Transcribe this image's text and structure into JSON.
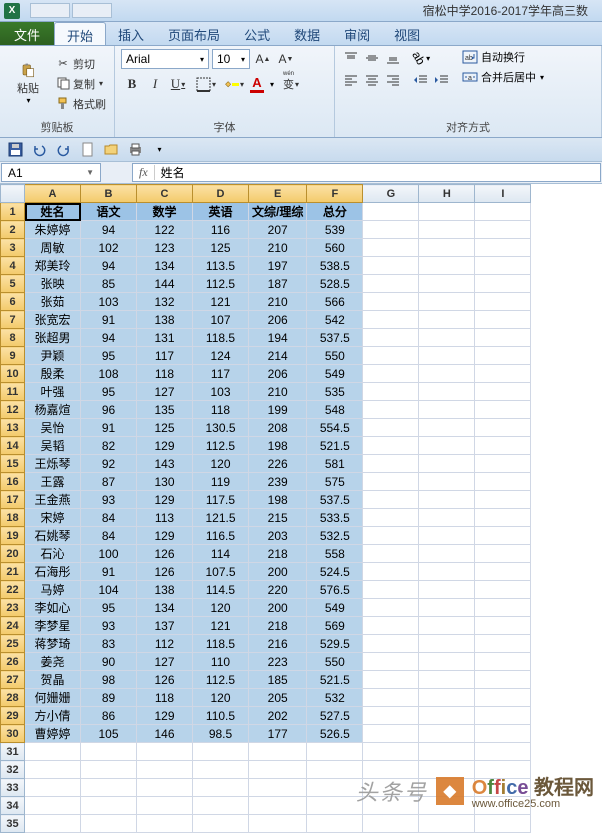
{
  "window": {
    "title": "宿松中学2016-2017学年高三数"
  },
  "ribbon": {
    "file": "文件",
    "tabs": [
      "开始",
      "插入",
      "页面布局",
      "公式",
      "数据",
      "审阅",
      "视图"
    ],
    "active": 0,
    "clipboard": {
      "paste": "粘贴",
      "cut": "剪切",
      "copy": "复制",
      "format_painter": "格式刷",
      "group_label": "剪贴板"
    },
    "font": {
      "name": "Arial",
      "size": "10",
      "group_label": "字体"
    },
    "alignment": {
      "wrap": "自动换行",
      "merge": "合并后居中",
      "group_label": "对齐方式"
    }
  },
  "fbar": {
    "name_box": "A1",
    "fx": "fx",
    "value": "姓名"
  },
  "columns": [
    "A",
    "B",
    "C",
    "D",
    "E",
    "F",
    "G",
    "H",
    "I"
  ],
  "selected_cols": [
    "A",
    "B",
    "C",
    "D",
    "E",
    "F"
  ],
  "row_count": 35,
  "selected_rows": 30,
  "chart_data": {
    "type": "table",
    "headers": [
      "姓名",
      "语文",
      "数学",
      "英语",
      "文综/理综",
      "总分"
    ],
    "rows": [
      [
        "朱婷婷",
        "94",
        "122",
        "116",
        "207",
        "539"
      ],
      [
        "周敏",
        "102",
        "123",
        "125",
        "210",
        "560"
      ],
      [
        "郑美玲",
        "94",
        "134",
        "113.5",
        "197",
        "538.5"
      ],
      [
        "张映",
        "85",
        "144",
        "112.5",
        "187",
        "528.5"
      ],
      [
        "张茹",
        "103",
        "132",
        "121",
        "210",
        "566"
      ],
      [
        "张宽宏",
        "91",
        "138",
        "107",
        "206",
        "542"
      ],
      [
        "张超男",
        "94",
        "131",
        "118.5",
        "194",
        "537.5"
      ],
      [
        "尹颖",
        "95",
        "117",
        "124",
        "214",
        "550"
      ],
      [
        "殷柔",
        "108",
        "118",
        "117",
        "206",
        "549"
      ],
      [
        "叶强",
        "95",
        "127",
        "103",
        "210",
        "535"
      ],
      [
        "杨嘉煊",
        "96",
        "135",
        "118",
        "199",
        "548"
      ],
      [
        "吴怡",
        "91",
        "125",
        "130.5",
        "208",
        "554.5"
      ],
      [
        "吴韬",
        "82",
        "129",
        "112.5",
        "198",
        "521.5"
      ],
      [
        "王烁琴",
        "92",
        "143",
        "120",
        "226",
        "581"
      ],
      [
        "王露",
        "87",
        "130",
        "119",
        "239",
        "575"
      ],
      [
        "王金燕",
        "93",
        "129",
        "117.5",
        "198",
        "537.5"
      ],
      [
        "宋婷",
        "84",
        "113",
        "121.5",
        "215",
        "533.5"
      ],
      [
        "石姚琴",
        "84",
        "129",
        "116.5",
        "203",
        "532.5"
      ],
      [
        "石沁",
        "100",
        "126",
        "114",
        "218",
        "558"
      ],
      [
        "石海彤",
        "91",
        "126",
        "107.5",
        "200",
        "524.5"
      ],
      [
        "马婷",
        "104",
        "138",
        "114.5",
        "220",
        "576.5"
      ],
      [
        "李如心",
        "95",
        "134",
        "120",
        "200",
        "549"
      ],
      [
        "李梦星",
        "93",
        "137",
        "121",
        "218",
        "569"
      ],
      [
        "蒋梦琦",
        "83",
        "112",
        "118.5",
        "216",
        "529.5"
      ],
      [
        "姜尧",
        "90",
        "127",
        "110",
        "223",
        "550"
      ],
      [
        "贺晶",
        "98",
        "126",
        "112.5",
        "185",
        "521.5"
      ],
      [
        "何姗姗",
        "89",
        "118",
        "120",
        "205",
        "532"
      ],
      [
        "方小倩",
        "86",
        "129",
        "110.5",
        "202",
        "527.5"
      ],
      [
        "曹婷婷",
        "105",
        "146",
        "98.5",
        "177",
        "526.5"
      ]
    ]
  },
  "watermark": {
    "left": "头条号",
    "brand": "Office",
    "suffix": "教程网",
    "url": "www.office25.com"
  }
}
